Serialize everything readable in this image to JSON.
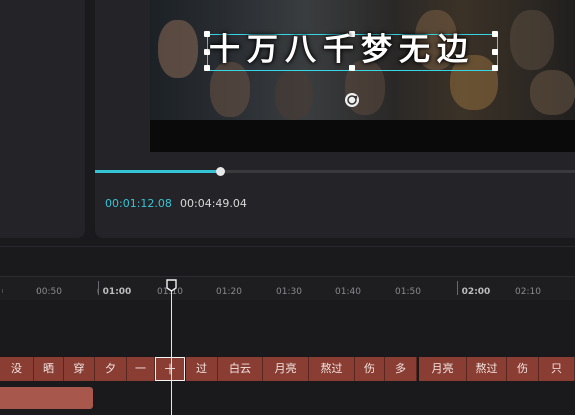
{
  "player": {
    "caption": "十万八千梦无边",
    "time_current": "00:01:12.08",
    "time_total": "00:04:49.04",
    "progress": 0.2494
  },
  "timeline": {
    "ruler_labels": [
      "00:50",
      "01:00",
      "01:10",
      "01:20",
      "01:30",
      "01:40",
      "01:50",
      "02:00",
      "02:10"
    ],
    "caption_clips": [
      "没",
      "晒",
      "穿",
      "夕",
      "一",
      "十",
      "过",
      "白云",
      "月亮",
      "熬过",
      "伤",
      "多",
      "月亮",
      "熬过",
      "伤",
      "只"
    ],
    "selected_clip": "十"
  },
  "colors": {
    "accent": "#35c4d6",
    "clip": "#8a3d33",
    "audio_clip": "#a8574d",
    "background": "#1a1a1d"
  }
}
